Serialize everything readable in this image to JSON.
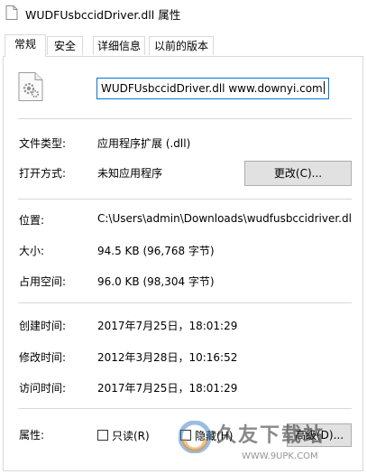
{
  "window": {
    "title": "WUDFUsbccidDriver.dll 属性"
  },
  "tabs": [
    {
      "label": "常规",
      "active": true
    },
    {
      "label": "安全",
      "active": false
    },
    {
      "label": "详细信息",
      "active": false
    },
    {
      "label": "以前的版本",
      "active": false
    }
  ],
  "file": {
    "icon": "dll-gear-file-icon",
    "name_value": "WUDFUsbccidDriver.dll www.downyi.com"
  },
  "rows": {
    "type": {
      "label": "文件类型:",
      "value": "应用程序扩展 (.dll)"
    },
    "opens_with": {
      "label": "打开方式:",
      "value": "未知应用程序",
      "button": "更改(C)..."
    },
    "location": {
      "label": "位置:",
      "value": "C:\\Users\\admin\\Downloads\\wudfusbccidriver.dl"
    },
    "size": {
      "label": "大小:",
      "value": "94.5 KB (96,768 字节)"
    },
    "size_on_disk": {
      "label": "占用空间:",
      "value": "96.0 KB (98,304 字节)"
    },
    "created": {
      "label": "创建时间:",
      "value": "2017年7月25日，18:01:29"
    },
    "modified": {
      "label": "修改时间:",
      "value": "2012年3月28日，10:16:52"
    },
    "accessed": {
      "label": "访问时间:",
      "value": "2017年7月25日，18:01:29"
    }
  },
  "attributes": {
    "label": "属性:",
    "readonly": {
      "label": "只读(R)",
      "checked": false
    },
    "hidden": {
      "label": "隐藏(H)",
      "checked": false
    },
    "advanced_button": "高级(D)..."
  },
  "watermark": {
    "text": "久友下载站",
    "url": "WWW.9UPK.COM"
  },
  "colors": {
    "accent": "#0078d7",
    "button_bg": "#e1e1e1",
    "separator": "#d8d8d8"
  }
}
